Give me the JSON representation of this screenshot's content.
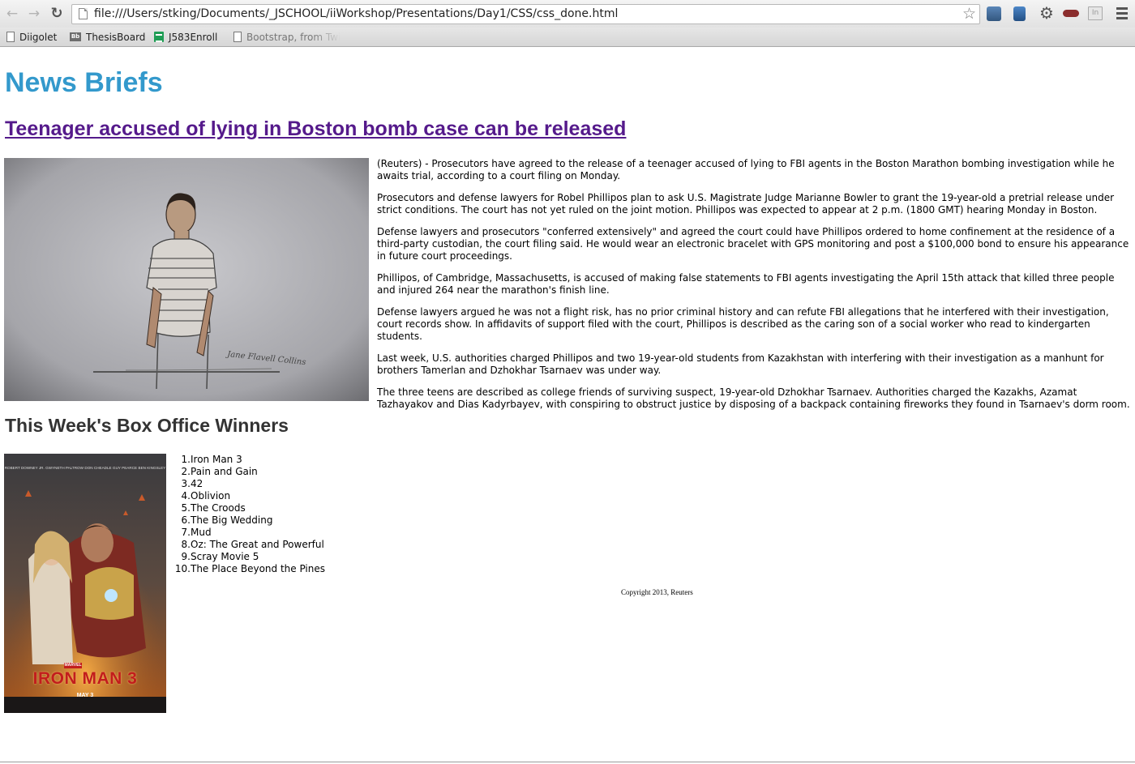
{
  "browser": {
    "url": "file:///Users/stking/Documents/_JSCHOOL/iiWorkshop/Presentations/Day1/CSS/css_done.html",
    "back_icon": "arrow-left-icon",
    "forward_icon": "arrow-right-icon",
    "reload_icon": "reload-icon",
    "star_icon": "star-icon",
    "bookmarks": [
      {
        "label": "Diigolet",
        "icon": "page-icon"
      },
      {
        "label": "ThesisBoard",
        "icon": "blackboard-icon"
      },
      {
        "label": "J583Enroll",
        "icon": "spreadsheet-icon"
      },
      {
        "label": "Bootstrap, from Twi",
        "icon": "page-icon"
      }
    ]
  },
  "page": {
    "site_title": "News Briefs",
    "headline": "Teenager accused of lying in Boston bomb case can be released",
    "sketch_signature": "Jane Flavell Collins",
    "article_paragraphs": [
      "(Reuters) - Prosecutors have agreed to the release of a teenager accused of lying to FBI agents in the Boston Marathon bombing investigation while he awaits trial, according to a court filing on Monday.",
      "Prosecutors and defense lawyers for Robel Phillipos plan to ask U.S. Magistrate Judge Marianne Bowler to grant the 19-year-old a pretrial release under strict conditions. The court has not yet ruled on the joint motion. Phillipos was expected to appear at 2 p.m. (1800 GMT) hearing Monday in Boston.",
      "Defense lawyers and prosecutors \"conferred extensively\" and agreed the court could have Phillipos ordered to home confinement at the residence of a third-party custodian, the court filing said. He would wear an electronic bracelet with GPS monitoring and post a $100,000 bond to ensure his appearance in future court proceedings.",
      "Phillipos, of Cambridge, Massachusetts, is accused of making false statements to FBI agents investigating the April 15th attack that killed three people and injured 264 near the marathon's finish line.",
      "Defense lawyers argued he was not a flight risk, has no prior criminal history and can refute FBI allegations that he interfered with their investigation, court records show. In affidavits of support filed with the court, Phillipos is described as the caring son of a social worker who read to kindergarten students.",
      "Last week, U.S. authorities charged Phillipos and two 19-year-old students from Kazakhstan with interfering with their investigation as a manhunt for brothers Tamerlan and Dzhokhar Tsarnaev was under way.",
      "The three teens are described as college friends of surviving suspect, 19-year-old Dzhokhar Tsarnaev. Authorities charged the Kazakhs, Azamat Tazhayakov and Dias Kadyrbayev, with conspiring to obstruct justice by disposing of a backpack containing fireworks they found in Tsarnaev's dorm room."
    ],
    "box_office_title": "This Week's Box Office Winners",
    "poster": {
      "credits": [
        "ROBERT DOWNEY JR.",
        "GWYNETH PALTROW",
        "DON CHEADLE",
        "GUY PEARCE",
        "BEN KINGSLEY"
      ],
      "studio": "MARVEL",
      "title": "IRON MAN 3",
      "date": "MAY 3"
    },
    "films": [
      {
        "num": "1.",
        "title": "Iron Man 3"
      },
      {
        "num": "2.",
        "title": "Pain and Gain"
      },
      {
        "num": "3.",
        "title": "42"
      },
      {
        "num": "4.",
        "title": "Oblivion"
      },
      {
        "num": "5.",
        "title": "The Croods"
      },
      {
        "num": "6.",
        "title": "The Big Wedding"
      },
      {
        "num": "7.",
        "title": "Mud"
      },
      {
        "num": "8.",
        "title": "Oz: The Great and Powerful"
      },
      {
        "num": "9.",
        "title": "Scray Movie 5"
      },
      {
        "num": "10.",
        "title": "The Place Beyond the Pines"
      }
    ],
    "copyright": "Copyright 2013, Reuters"
  },
  "colors": {
    "title": "#3399cc",
    "visited_link": "#551a8b",
    "heading": "#333333"
  }
}
